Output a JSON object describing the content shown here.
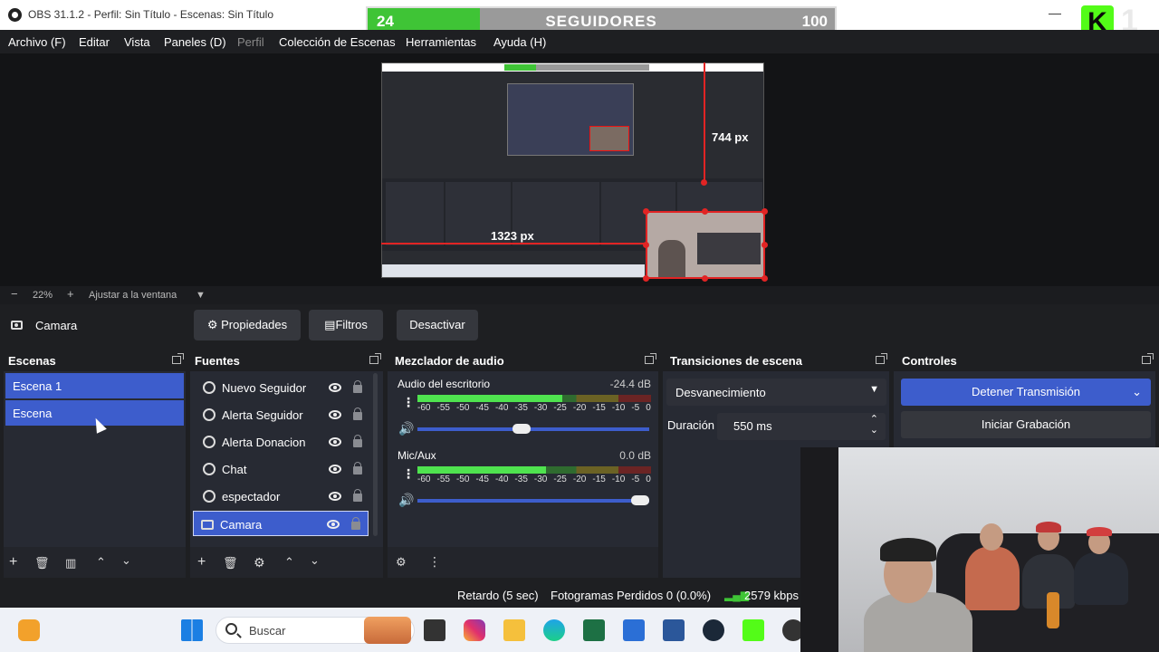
{
  "window": {
    "title": "OBS 31.1.2 - Perfil: Sin Título - Escenas: Sin Título",
    "minimize": "—"
  },
  "overlay": {
    "followers_current": "24",
    "followers_label": "SEGUIDORES",
    "followers_goal": "100",
    "followers_progress": 0.24,
    "kick_logo": "K",
    "kick_count": "1"
  },
  "menu": {
    "items": [
      "Archivo (F)",
      "Editar",
      "Vista",
      "Paneles (D)",
      "Perfil",
      "Colección de Escenas",
      "Herramientas",
      "Ayuda (H)"
    ]
  },
  "preview": {
    "width_label": "1323 px",
    "height_label": "744 px"
  },
  "zoom": {
    "minus": "−",
    "value": "22%",
    "plus": "+",
    "fit": "Ajustar a la ventana",
    "arrow": "▼"
  },
  "source_toolbar": {
    "selected": "Camara",
    "properties": "Propiedades",
    "filters": "Filtros",
    "deactivate": "Desactivar"
  },
  "scenes": {
    "title": "Escenas",
    "items": [
      "Escena 1",
      "Escena"
    ]
  },
  "sources": {
    "title": "Fuentes",
    "items": [
      "Nuevo Seguidor",
      "Alerta Seguidor",
      "Alerta Donacion",
      "Chat",
      "espectador",
      "Camara"
    ]
  },
  "mixer": {
    "title": "Mezclador de audio",
    "scale": [
      "-60",
      "-55",
      "-50",
      "-45",
      "-40",
      "-35",
      "-30",
      "-25",
      "-20",
      "-15",
      "-10",
      "-5",
      "0"
    ],
    "channels": [
      {
        "name": "Audio del escritorio",
        "db": "-24.4 dB",
        "level": 0.62,
        "volume": 0.45
      },
      {
        "name": "Mic/Aux",
        "db": "0.0 dB",
        "level": 0.55,
        "volume": 0.96
      }
    ]
  },
  "transitions": {
    "title": "Transiciones de escena",
    "selected": "Desvanecimiento",
    "duration_label": "Duración",
    "duration_value": "550 ms"
  },
  "controls": {
    "title": "Controles",
    "stop_stream": "Detener Transmisión",
    "start_recording": "Iniciar Grabación"
  },
  "status": {
    "delay": "Retardo (5 sec)",
    "dropped": "Fotogramas Perdidos 0 (0.0%)",
    "bitrate": "2579 kbps"
  },
  "taskbar": {
    "search_placeholder": "Buscar",
    "icons": [
      "widgets-icon",
      "windows-start-icon",
      "search-icon",
      "game-icon",
      "file-manager-icon",
      "instagram-icon",
      "folder-icon",
      "edge-icon",
      "excel-icon",
      "store-icon",
      "word-icon",
      "steam-icon",
      "kick-icon",
      "obs-icon"
    ]
  },
  "colors": {
    "accent": "#3d5dcc",
    "follower_bar": "#3fc436",
    "kick": "#53fc18",
    "selection": "#e12424"
  }
}
